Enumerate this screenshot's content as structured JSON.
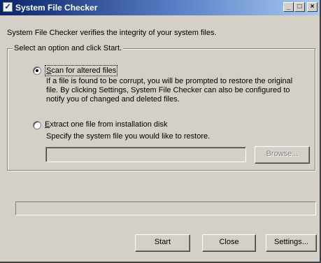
{
  "window": {
    "title": "System File Checker",
    "title_icon": "checkmark-icon",
    "minimize_glyph": "_",
    "maximize_glyph": "□",
    "close_glyph": "×"
  },
  "description": "System File Checker verifies the integrity of your system files.",
  "group": {
    "label": "Select an option and click Start.",
    "options": [
      {
        "label": "Scan for altered files",
        "selected": true,
        "help": "If a file is found to be corrupt, you will be prompted to restore the original file. By clicking Settings, System File Checker can also be configured to notify you of changed and deleted files."
      },
      {
        "label": "Extract one file from installation disk",
        "selected": false,
        "help": "Specify the system file you would like to restore."
      }
    ],
    "file_input": {
      "value": "",
      "placeholder": ""
    },
    "browse_label": "Browse...",
    "browse_enabled": false
  },
  "progress": {
    "value": 0
  },
  "buttons": {
    "start": "Start",
    "close": "Close",
    "settings": "Settings..."
  },
  "colors": {
    "face": "#d4d0c8",
    "title_start": "#0a246a",
    "title_end": "#a6caf0"
  }
}
